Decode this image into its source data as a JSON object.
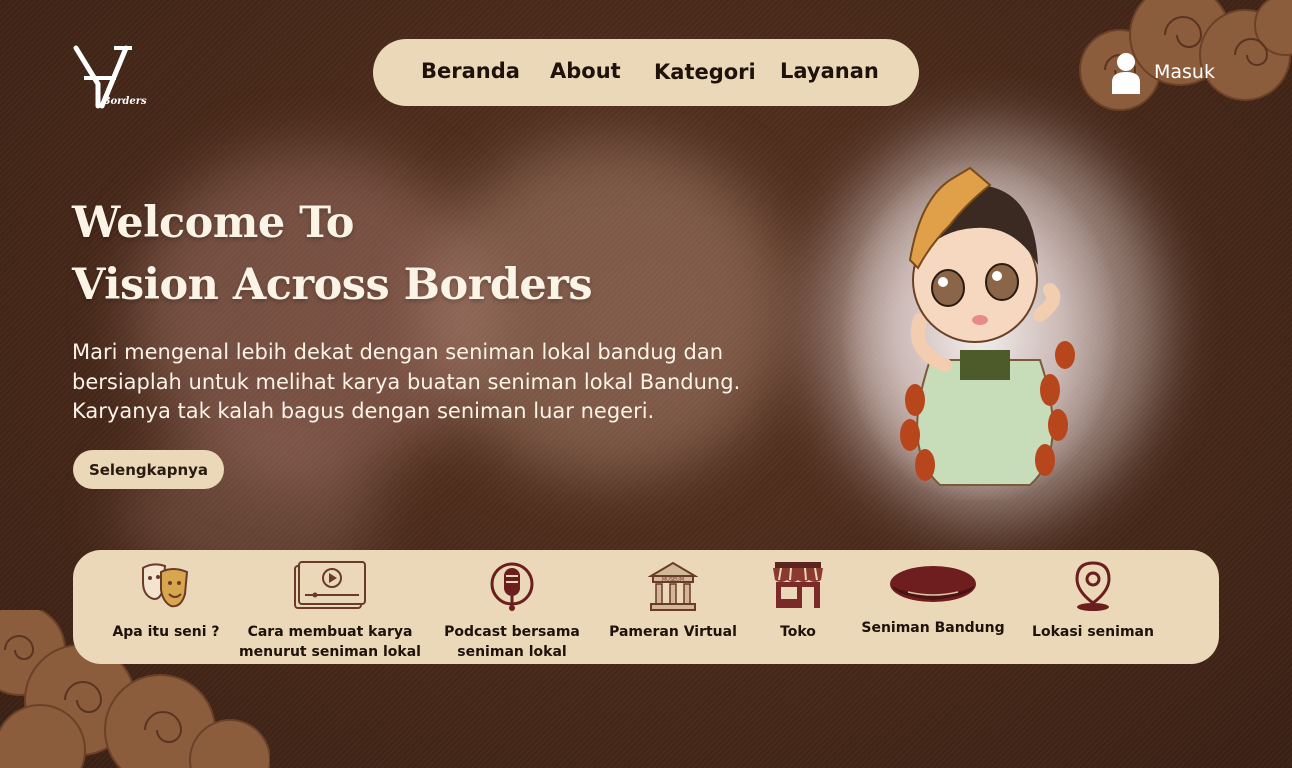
{
  "brand": {
    "logo_text": "Borders"
  },
  "nav": {
    "items": [
      "Beranda",
      "About",
      "Kategori",
      "Layanan"
    ],
    "login_label": "Masuk"
  },
  "hero": {
    "title_line1": "Welcome To",
    "title_line2": "Vision Across Borders",
    "desc_lines": [
      "Mari mengenal lebih dekat dengan seniman lokal bandug dan",
      "bersiaplah untuk melihat karya buatan seniman lokal Bandung.",
      "Karyanya tak kalah bagus dengan seniman luar negeri."
    ],
    "cta_label": "Selengkapnya"
  },
  "categories": [
    {
      "label_lines": [
        "Apa itu seni ?"
      ],
      "icon": "theater-masks-icon"
    },
    {
      "label_lines": [
        "Cara membuat karya",
        "menurut seniman lokal"
      ],
      "icon": "video-player-icon"
    },
    {
      "label_lines": [
        "Podcast bersama",
        "seniman lokal"
      ],
      "icon": "microphone-icon"
    },
    {
      "label_lines": [
        "Pameran Virtual"
      ],
      "icon": "museum-icon",
      "icon_text": "MUSEUM"
    },
    {
      "label_lines": [
        "Toko"
      ],
      "icon": "store-icon"
    },
    {
      "label_lines": [
        "Seniman Bandung"
      ],
      "icon": "beret-icon"
    },
    {
      "label_lines": [
        "Lokasi seniman"
      ],
      "icon": "location-pin-icon"
    }
  ],
  "colors": {
    "background": "#4a2a1a",
    "cream": "#ead8b8",
    "text_dark": "#1e120b",
    "accent_maroon": "#6e1e1e"
  }
}
